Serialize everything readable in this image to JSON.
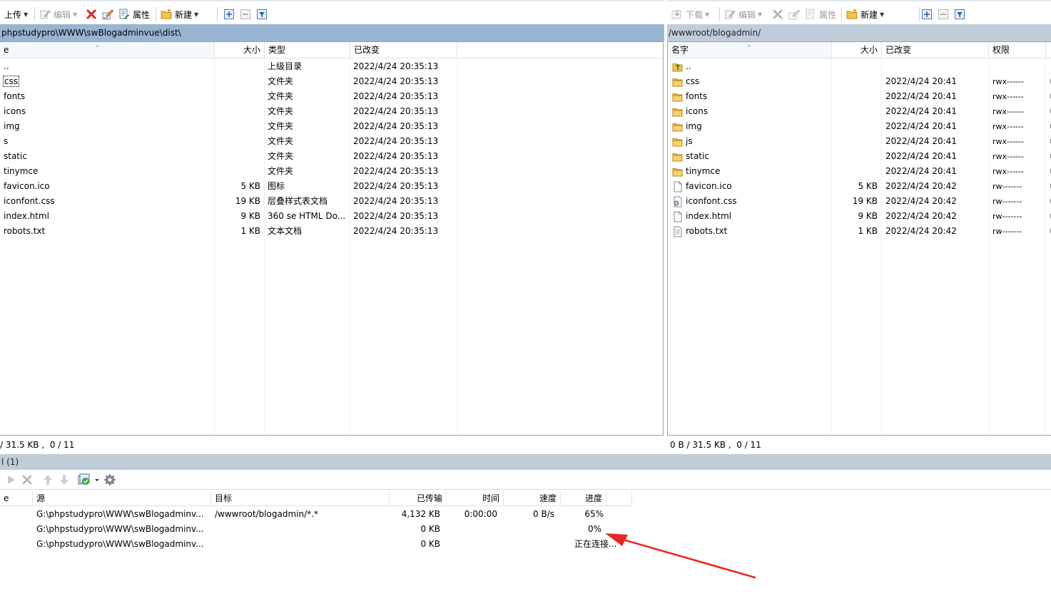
{
  "left_toolbar": {
    "upload_label": "上传",
    "edit_label": "编辑",
    "properties_label": "属性",
    "new_label": "新建"
  },
  "right_toolbar": {
    "download_label": "下载",
    "edit_label": "编辑",
    "properties_label": "属性",
    "new_label": "新建"
  },
  "left_pane": {
    "path": "phpstudypro\\WWW\\swBlogadminvue\\dist\\",
    "columns": {
      "name": "e",
      "size": "大小",
      "type": "类型",
      "modified": "已改变"
    },
    "files": [
      {
        "name": "..",
        "size": "",
        "type": "上级目录",
        "modified": "2022/4/24  20:35:13"
      },
      {
        "name": "css",
        "size": "",
        "type": "文件夹",
        "modified": "2022/4/24  20:35:13"
      },
      {
        "name": "fonts",
        "size": "",
        "type": "文件夹",
        "modified": "2022/4/24  20:35:13"
      },
      {
        "name": "icons",
        "size": "",
        "type": "文件夹",
        "modified": "2022/4/24  20:35:13"
      },
      {
        "name": "img",
        "size": "",
        "type": "文件夹",
        "modified": "2022/4/24  20:35:13"
      },
      {
        "name": "s",
        "size": "",
        "type": "文件夹",
        "modified": "2022/4/24  20:35:13"
      },
      {
        "name": "static",
        "size": "",
        "type": "文件夹",
        "modified": "2022/4/24  20:35:13"
      },
      {
        "name": "tinymce",
        "size": "",
        "type": "文件夹",
        "modified": "2022/4/24  20:35:13"
      },
      {
        "name": "favicon.ico",
        "size": "5 KB",
        "type": "图标",
        "modified": "2022/4/24  20:35:13"
      },
      {
        "name": "iconfont.css",
        "size": "19 KB",
        "type": "层叠样式表文档",
        "modified": "2022/4/24  20:35:13"
      },
      {
        "name": "index.html",
        "size": "9 KB",
        "type": "360 se HTML Do...",
        "modified": "2022/4/24  20:35:13"
      },
      {
        "name": "robots.txt",
        "size": "1 KB",
        "type": "文本文档",
        "modified": "2022/4/24  20:35:13"
      }
    ],
    "status": "/ 31.5 KB ,  0 / 11"
  },
  "right_pane": {
    "path": "/wwwroot/blogadmin/",
    "columns": {
      "name": "名字",
      "size": "大小",
      "modified": "已改变",
      "perms": "权限"
    },
    "files": [
      {
        "name": "..",
        "size": "",
        "modified": "",
        "perms": "",
        "icon": "parent-folder-icon"
      },
      {
        "name": "css",
        "size": "",
        "modified": "2022/4/24 20:41",
        "perms": "rwx------",
        "icon": "folder-icon"
      },
      {
        "name": "fonts",
        "size": "",
        "modified": "2022/4/24 20:41",
        "perms": "rwx------",
        "icon": "folder-icon"
      },
      {
        "name": "icons",
        "size": "",
        "modified": "2022/4/24 20:41",
        "perms": "rwx------",
        "icon": "folder-icon"
      },
      {
        "name": "img",
        "size": "",
        "modified": "2022/4/24 20:41",
        "perms": "rwx------",
        "icon": "folder-icon"
      },
      {
        "name": "js",
        "size": "",
        "modified": "2022/4/24 20:41",
        "perms": "rwx------",
        "icon": "folder-icon"
      },
      {
        "name": "static",
        "size": "",
        "modified": "2022/4/24 20:41",
        "perms": "rwx------",
        "icon": "folder-icon"
      },
      {
        "name": "tinymce",
        "size": "",
        "modified": "2022/4/24 20:41",
        "perms": "rwx------",
        "icon": "folder-icon"
      },
      {
        "name": "favicon.ico",
        "size": "5 KB",
        "modified": "2022/4/24 20:42",
        "perms": "rw-------",
        "icon": "file-icon"
      },
      {
        "name": "iconfont.css",
        "size": "19 KB",
        "modified": "2022/4/24 20:42",
        "perms": "rw-------",
        "icon": "css-file-icon"
      },
      {
        "name": "index.html",
        "size": "9 KB",
        "modified": "2022/4/24 20:42",
        "perms": "rw-------",
        "icon": "file-icon"
      },
      {
        "name": "robots.txt",
        "size": "1 KB",
        "modified": "2022/4/24 20:42",
        "perms": "rw-------",
        "icon": "text-file-icon"
      }
    ],
    "status": "0 B / 31.5 KB ,  0 / 11"
  },
  "queue": {
    "title": "l (1)",
    "columns": {
      "name": "e",
      "source": "源",
      "target": "目标",
      "transferred": "已传输",
      "time": "时间",
      "speed": "速度",
      "progress": "进度"
    },
    "rows": [
      {
        "source": "G:\\phpstudypro\\WWW\\swBlogadminv...",
        "target": "/wwwroot/blogadmin/*.*",
        "transferred": "4,132 KB",
        "time": "0:00:00",
        "speed": "0 B/s",
        "progress": "65%"
      },
      {
        "source": "G:\\phpstudypro\\WWW\\swBlogadminv...",
        "target": "",
        "transferred": "0 KB",
        "time": "",
        "speed": "",
        "progress": "0%"
      },
      {
        "source": "G:\\phpstudypro\\WWW\\swBlogadminv...",
        "target": "",
        "transferred": "0 KB",
        "time": "",
        "speed": "",
        "progress": "正在连接..."
      }
    ]
  },
  "colors": {
    "left_path_bg": "#99b4d1",
    "right_path_bg": "#bfcddb",
    "annotation_arrow": "#e8281e",
    "delete_red": "#d9261c",
    "folder_yellow": "#f2c24b"
  }
}
